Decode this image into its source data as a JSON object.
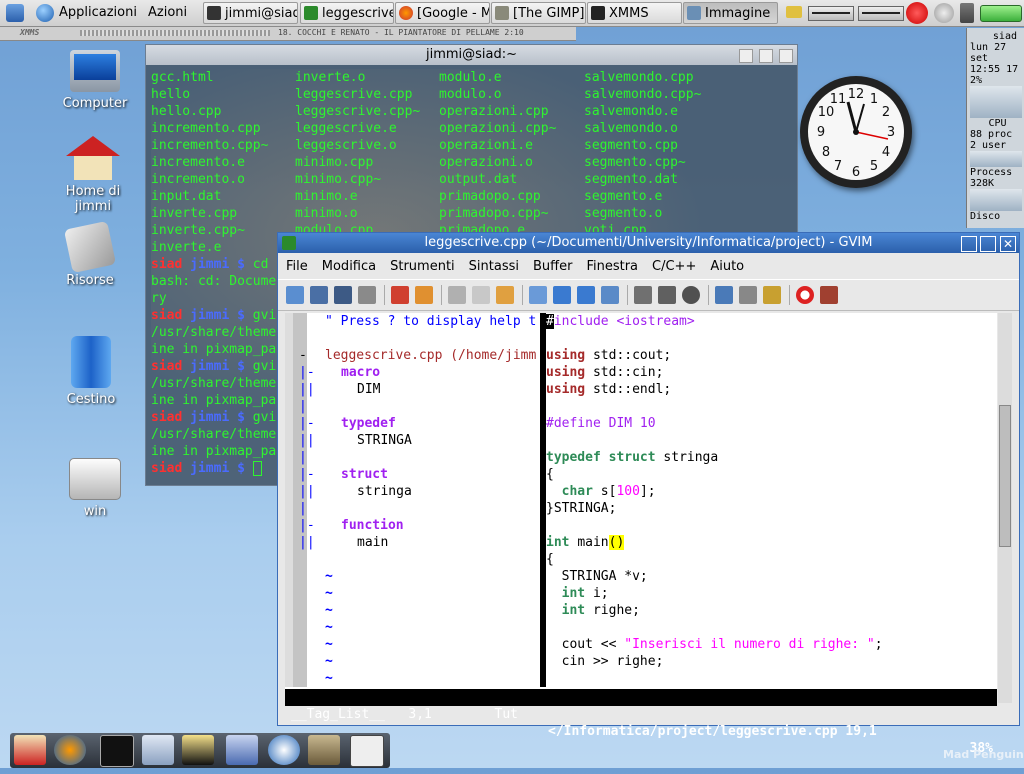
{
  "top_panel": {
    "applications_label": "Applicazioni",
    "actions_label": "Azioni",
    "tasks": [
      {
        "label": "jimmi@siad"
      },
      {
        "label": "leggescrive"
      },
      {
        "label": "[Google - M"
      },
      {
        "label": "[The GIMP]"
      },
      {
        "label": "XMMS"
      },
      {
        "label": "Immagine"
      }
    ]
  },
  "xmms": {
    "label": "XMMS",
    "track": "18. COCCHI E RENATO - IL PIANTATORE DI PELLAME   2:10"
  },
  "desktop_icons": [
    {
      "label": "Computer"
    },
    {
      "label": "Home di jimmi"
    },
    {
      "label": "Risorse"
    },
    {
      "label": "Cestino"
    },
    {
      "label": "win"
    }
  ],
  "terminal": {
    "title": "jimmi@siad:~",
    "col1": [
      "gcc.html",
      "hello",
      "hello.cpp",
      "incremento.cpp",
      "incremento.cpp~",
      "incremento.e",
      "incremento.o",
      "input.dat",
      "inverte.cpp",
      "inverte.cpp~",
      "inverte.e"
    ],
    "col2": [
      "inverte.o",
      "leggescrive.cpp",
      "leggescrive.cpp~",
      "leggescrive.e",
      "leggescrive.o",
      "minimo.cpp",
      "minimo.cpp~",
      "minimo.e",
      "minimo.o",
      "modulo.cpp"
    ],
    "col3": [
      "modulo.e",
      "modulo.o",
      "operazioni.cpp",
      "operazioni.cpp~",
      "operazioni.e",
      "operazioni.o",
      "output.dat",
      "primadopo.cpp",
      "primadopo.cpp~",
      "primadopo.e"
    ],
    "col4": [
      "salvemondo.cpp",
      "salvemondo.cpp~",
      "salvemondo.e",
      "salvemondo.o",
      "segmento.cpp",
      "segmento.cpp~",
      "segmento.dat",
      "segmento.e",
      "segmento.o",
      "voti.cpp"
    ],
    "prompt_host": "siad",
    "prompt_user": "jimmi",
    "prompt_sym": "$",
    "lines": {
      "l1_cmd": "cd",
      "l2": "bash: cd: Docume",
      "l3": "ry",
      "l4_cmd": "gvi",
      "l5": "/usr/share/theme",
      "l6": "ine in pixmap_pa",
      "l7_cmd": "gvi",
      "l8": "/usr/share/theme",
      "l9": "ine in pixmap_pa",
      "l10_cmd": "gvi",
      "l11": "/usr/share/theme",
      "l12": "ine in pixmap_pa"
    }
  },
  "monitor": {
    "host": "siad",
    "date": "lun 27 set",
    "time": "12:55 17",
    "cpu_pct": "2%",
    "cpu_label": "CPU",
    "procs": "88 proc",
    "users": "2 user",
    "process_label": "Process",
    "mem": "328K",
    "disk_label": "Disco"
  },
  "gvim": {
    "title": "leggescrive.cpp (~/Documenti/University/Informatica/project) - GVIM",
    "menu": [
      "File",
      "Modifica",
      "Strumenti",
      "Sintassi",
      "Buffer",
      "Finestra",
      "C/C++",
      "Aiuto"
    ],
    "taglist": {
      "help": "\" Press ? to display help t",
      "file": "leggescrive.cpp (/home/jimm",
      "macro": "macro",
      "dim": "DIM",
      "typedef": "typedef",
      "stringa_t": "STRINGA",
      "struct": "struct",
      "stringa_s": "stringa",
      "function": "function",
      "main": "main"
    },
    "code": {
      "include": "#include <iostream>",
      "using1": "std::cout;",
      "using2": "std::cin;",
      "using3": "std::endl;",
      "define": "#define DIM 10",
      "typedef_rest": "stringa",
      "open1": "{",
      "char_decl": "s[",
      "char_num": "100",
      "char_end": "];",
      "close1": "}STRINGA;",
      "main_name": "main",
      "main_parens": "()",
      "open2": "{",
      "stringa_decl": "  STRINGA *v;",
      "int_i": "i;",
      "int_righe": "righe;",
      "cout_pre": "  cout << ",
      "cout_str": "\"Inserisci il numero di righe: \"",
      "cout_end": ";",
      "cin": "  cin >> righe;"
    },
    "status_left": "__Tag_List__   3,1        Tut ",
    "status_right": "</Informatica/project/leggescrive.cpp 19,1",
    "status_pct": "38%"
  },
  "watermark": "Mad Penguin"
}
